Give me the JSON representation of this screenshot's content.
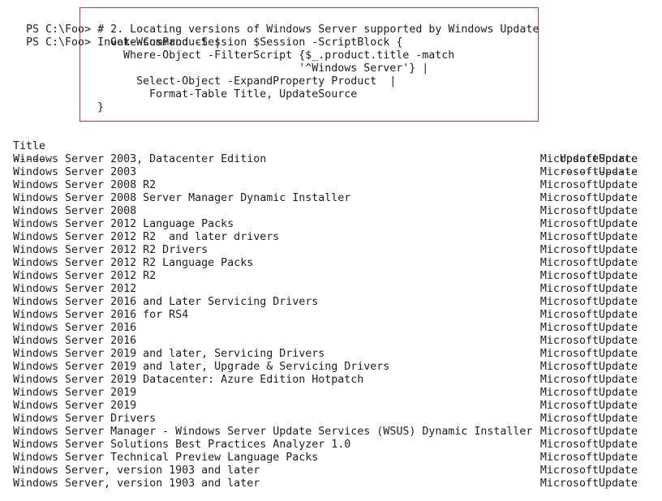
{
  "console": {
    "prompt_lines": [
      {
        "prompt": "PS C:\\Foo>",
        "command": " # 2. Locating versions of Windows Server supported by Windows Update"
      },
      {
        "prompt": "PS C:\\Foo>",
        "command": " Invoke-Command -Session $Session -ScriptBlock {"
      }
    ],
    "continuation_lines": [
      "    Get-WsusProduct |",
      "      Where-Object -FilterScript {$_.product.title -match",
      "                                 '^Windows Server'} |",
      "        Select-Object -ExpandProperty Product  |",
      "          Format-Table Title, UpdateSource",
      "  }"
    ]
  },
  "table": {
    "headers": {
      "title": "Title",
      "source": "UpdateSource"
    },
    "underlines": {
      "title": "-----",
      "source": "------------"
    },
    "rows": [
      {
        "title": "Windows Server 2003, Datacenter Edition",
        "source": "MicrosoftUpdate"
      },
      {
        "title": "Windows Server 2003",
        "source": "MicrosoftUpdate"
      },
      {
        "title": "Windows Server 2008 R2",
        "source": "MicrosoftUpdate"
      },
      {
        "title": "Windows Server 2008 Server Manager Dynamic Installer",
        "source": "MicrosoftUpdate"
      },
      {
        "title": "Windows Server 2008",
        "source": "MicrosoftUpdate"
      },
      {
        "title": "Windows Server 2012 Language Packs",
        "source": "MicrosoftUpdate"
      },
      {
        "title": "Windows Server 2012 R2  and later drivers",
        "source": "MicrosoftUpdate"
      },
      {
        "title": "Windows Server 2012 R2 Drivers",
        "source": "MicrosoftUpdate"
      },
      {
        "title": "Windows Server 2012 R2 Language Packs",
        "source": "MicrosoftUpdate"
      },
      {
        "title": "Windows Server 2012 R2",
        "source": "MicrosoftUpdate"
      },
      {
        "title": "Windows Server 2012",
        "source": "MicrosoftUpdate"
      },
      {
        "title": "Windows Server 2016 and Later Servicing Drivers",
        "source": "MicrosoftUpdate"
      },
      {
        "title": "Windows Server 2016 for RS4",
        "source": "MicrosoftUpdate"
      },
      {
        "title": "Windows Server 2016",
        "source": "MicrosoftUpdate"
      },
      {
        "title": "Windows Server 2016",
        "source": "MicrosoftUpdate"
      },
      {
        "title": "Windows Server 2019 and later, Servicing Drivers",
        "source": "MicrosoftUpdate"
      },
      {
        "title": "Windows Server 2019 and later, Upgrade & Servicing Drivers",
        "source": "MicrosoftUpdate"
      },
      {
        "title": "Windows Server 2019 Datacenter: Azure Edition Hotpatch",
        "source": "MicrosoftUpdate"
      },
      {
        "title": "Windows Server 2019",
        "source": "MicrosoftUpdate"
      },
      {
        "title": "Windows Server 2019",
        "source": "MicrosoftUpdate"
      },
      {
        "title": "Windows Server Drivers",
        "source": "MicrosoftUpdate"
      },
      {
        "title": "Windows Server Manager - Windows Server Update Services (WSUS) Dynamic Installer",
        "source": "MicrosoftUpdate"
      },
      {
        "title": "Windows Server Solutions Best Practices Analyzer 1.0",
        "source": "MicrosoftUpdate"
      },
      {
        "title": "Windows Server Technical Preview Language Packs",
        "source": "MicrosoftUpdate"
      },
      {
        "title": "Windows Server, version 1903 and later",
        "source": "MicrosoftUpdate"
      },
      {
        "title": "Windows Server, version 1903 and later",
        "source": "MicrosoftUpdate"
      }
    ]
  },
  "colors": {
    "highlight_border": "#d9333f",
    "text": "#1e1e1e",
    "background": "#ffffff"
  }
}
